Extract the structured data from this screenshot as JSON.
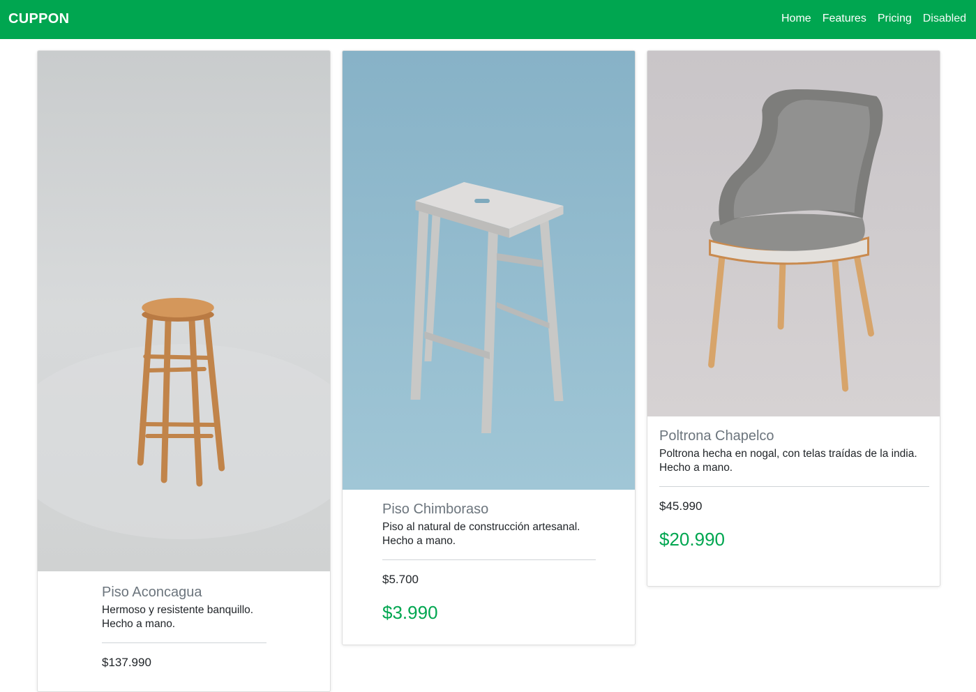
{
  "navbar": {
    "brand": "CUPPON",
    "links": [
      {
        "label": "Home"
      },
      {
        "label": "Features"
      },
      {
        "label": "Pricing"
      },
      {
        "label": "Disabled"
      }
    ]
  },
  "products": [
    {
      "title": "Piso Aconcagua",
      "description_line1": "Hermoso y resistente banquillo.",
      "description_line2": "Hecho a mano.",
      "old_price": "$137.990",
      "image": "wooden-bar-stool-photo"
    },
    {
      "title": "Piso Chimboraso",
      "description_line1": "Piso al natural de construcción artesanal.",
      "description_line2": "Hecho a mano.",
      "old_price": "$5.700",
      "price": "$3.990",
      "image": "grey-wooden-stool-photo"
    },
    {
      "title": "Poltrona Chapelco",
      "description_line1": "Poltrona hecha en nogal, con telas traídas de la india.",
      "description_line2": "Hecho a mano.",
      "old_price": "$45.990",
      "price": "$20.990",
      "image": "upholstered-armchair-photo"
    }
  ],
  "colors": {
    "brand_green": "#00a650",
    "title_grey": "#6c757d"
  }
}
